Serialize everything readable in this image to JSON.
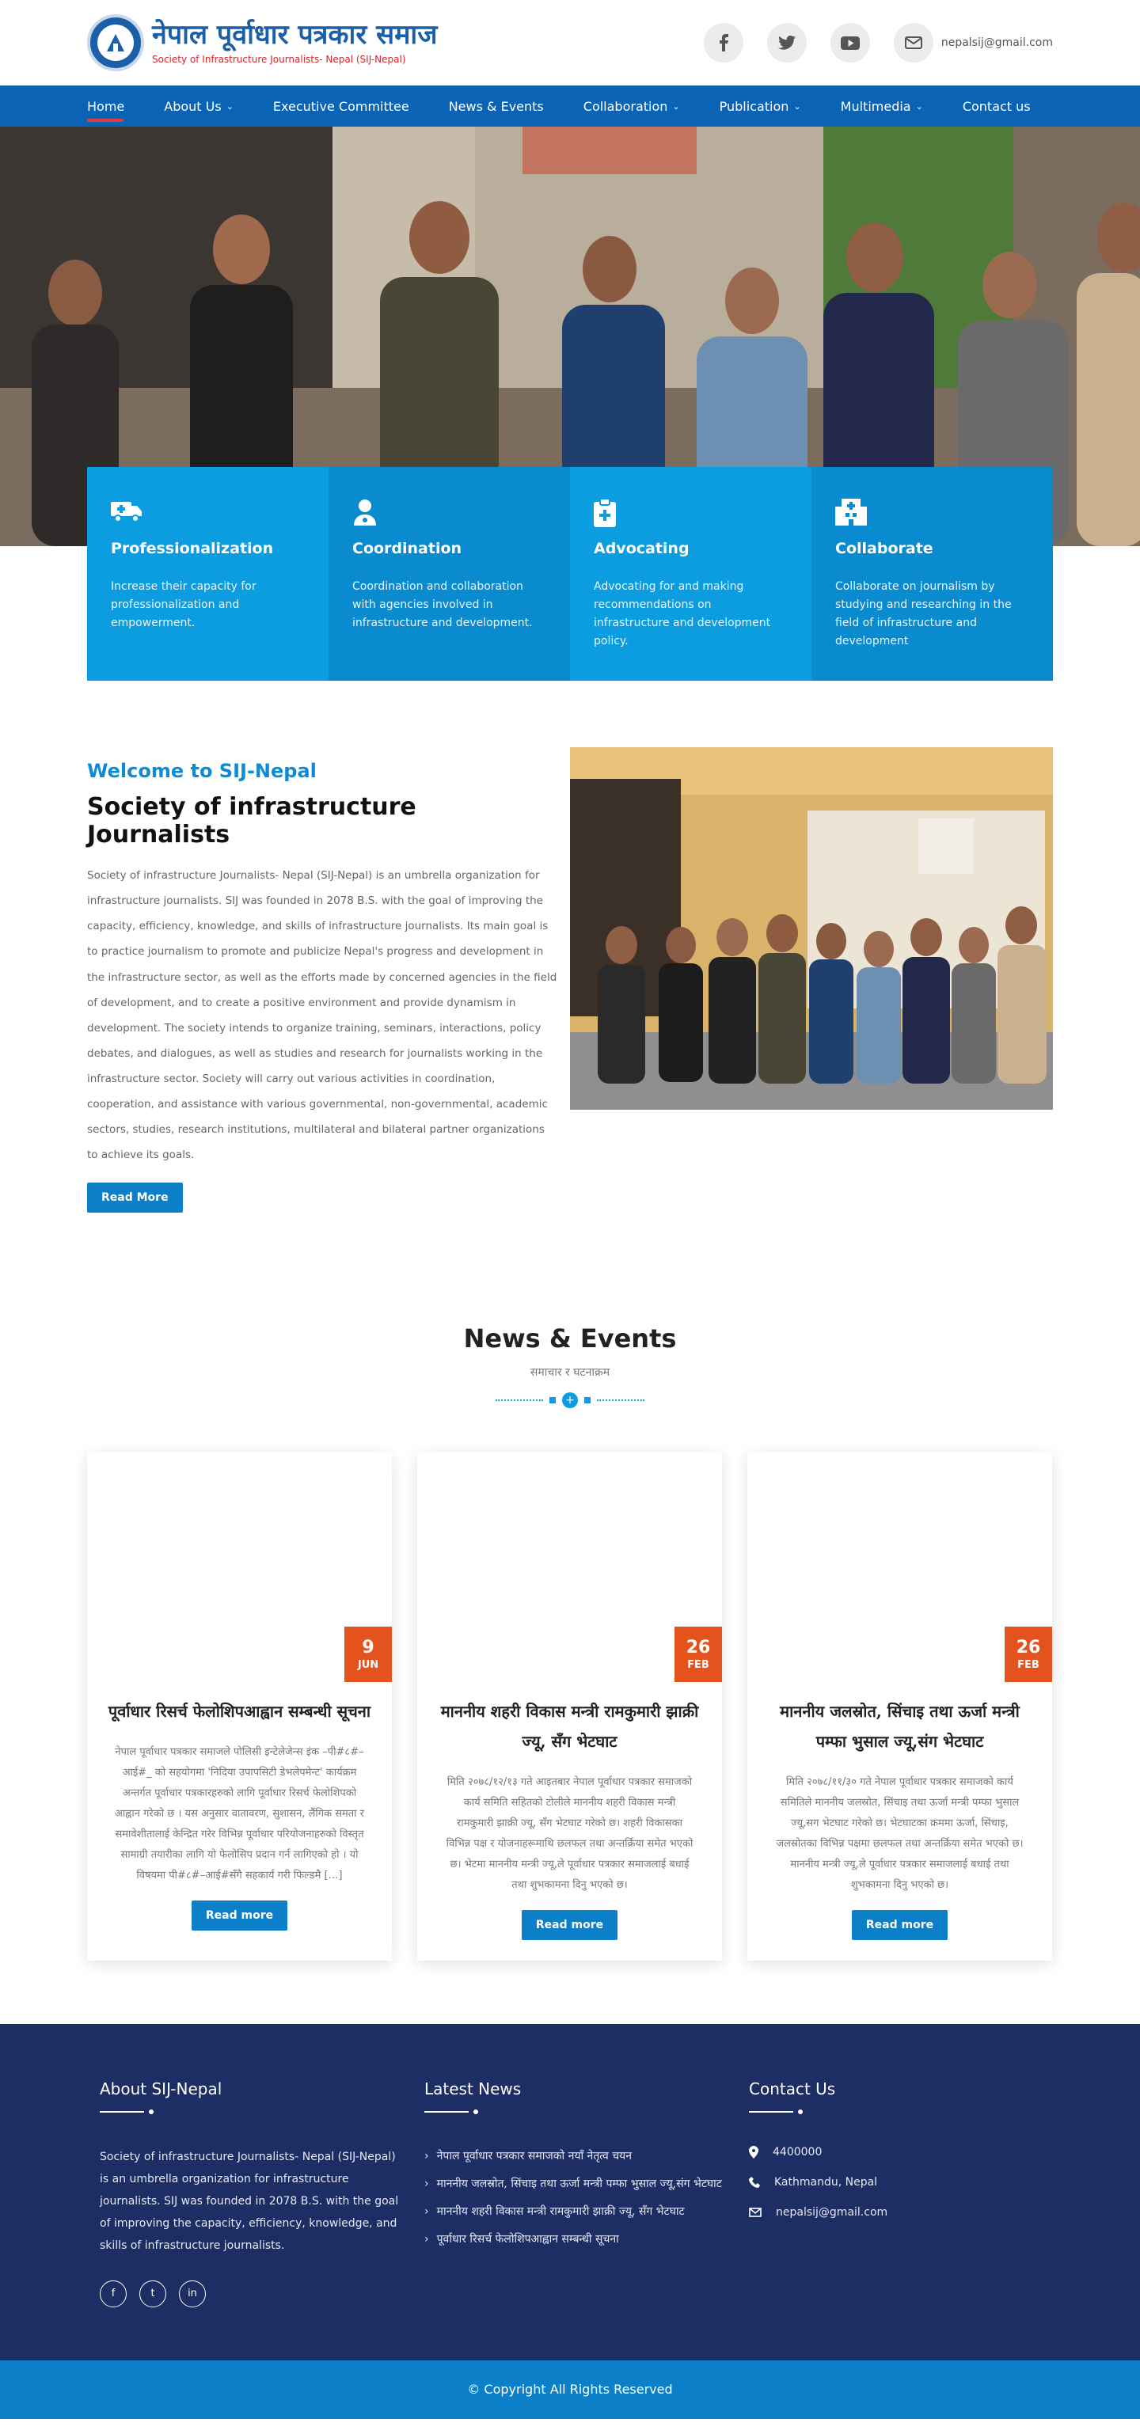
{
  "header": {
    "logo_np": "नेपाल पूर्वाधार पत्रकार समाज",
    "logo_en": "Society of Infrastructure Journalists- Nepal (SIJ-Nepal)",
    "email": "nepalsij@gmail.com",
    "social_icons": [
      "facebook-icon",
      "twitter-icon",
      "youtube-icon",
      "mail-icon"
    ]
  },
  "nav": {
    "items": [
      "Home",
      "About Us",
      "Executive Committee",
      "News & Events",
      "Collaboration",
      "Publication",
      "Multimedia",
      "Contact us"
    ],
    "active": "Home"
  },
  "features": [
    {
      "icon": "ambulance-icon",
      "title": "Professionalization",
      "text": "Increase their capacity for professionalization and empowerment."
    },
    {
      "icon": "user-doctor-icon",
      "title": "Coordination",
      "text": "Coordination and collaboration with agencies involved in infrastructure and development."
    },
    {
      "icon": "clipboard-medical-icon",
      "title": "Advocating",
      "text": "Advocating for and making recommendations on infrastructure and development policy."
    },
    {
      "icon": "hospital-icon",
      "title": "Collaborate",
      "text": "Collaborate on journalism by studying and researching in the field of infrastructure and development"
    }
  ],
  "welcome": {
    "kicker": "Welcome to SIJ-Nepal",
    "title": "Society of infrastructure Journalists",
    "body": "Society of infrastructure Journalists- Nepal (SIJ-Nepal) is an umbrella organization for infrastructure journalists. SIJ was founded in 2078 B.S. with the goal of improving the capacity, efficiency, knowledge, and skills of infrastructure journalists. Its main goal is to practice journalism to promote and publicize Nepal's progress and development in the infrastructure sector, as well as the efforts made by concerned agencies in the field of development, and to create a positive environment and provide dynamism in development. The society intends to organize training, seminars, interactions, policy debates, and dialogues, as well as studies and research for journalists working in the infrastructure sector. Society will carry out various activities in coordination, cooperation, and assistance with various governmental, non-governmental, academic sectors, studies, research institutions, multilateral and bilateral partner organizations to achieve its goals.",
    "button": "Read More"
  },
  "news": {
    "title": "News & Events",
    "subtitle": "समाचार र घटनाक्रम",
    "read_more": "Read more",
    "cards": [
      {
        "day": "9",
        "month": "JUN",
        "title": "पूर्वाधार रिसर्च फेलोशिपआह्वान सम्बन्धी सूचना",
        "body": "नेपाल पूर्वाधार पत्रकार समाजले पोलिसी इन्टेलेजेन्स इंक –पी#८#–आई#_ को सहयोगमा 'निदिया उपापसिटी डेभलेपमेन्ट' कार्यक्रम अन्तर्गत पूर्वाधार पत्रकारहरुको लागि पूर्वाधार रिसर्च फेलोशिपको आह्वान गरेको छ । यस अनुसार वातावरण, सुशासन, लैंगिक समता र समावेशीतालाई केन्द्रित गरेर विभिन्न पूर्वाधार परियोजनाहरुको विस्तृत सामाग्री तयारीका लागि यो फेलोसिप प्रदान गर्न लागिएको हो । यो विषयमा पी#८#–आई#सँगै सहकार्य गरी फिल्डमै […]"
      },
      {
        "day": "26",
        "month": "FEB",
        "title": "माननीय शहरी विकास मन्त्री रामकुमारी झाक्री ज्यू, सँग भेटघाट",
        "body": "मिति २०७८/१२/१३ गते आइतबार नेपाल पूर्वाधार पत्रकार समाजको कार्य समिति सहितको टोलीले माननीय शहरी विकास मन्त्री रामकुमारी झाक्री ज्यू, सँग भेटघाट गरेको छ। शहरी विकासका विभिन्न पक्ष र योजनाहरूमाथि छलफल तथा अन्तर्क्रिया समेत भएको छ। भेटमा माननीय मन्त्री ज्यू,ले पूर्वाधार पत्रकार समाजलाई बधाई तथा शुभकामना दिनु भएको छ।"
      },
      {
        "day": "26",
        "month": "FEB",
        "title": "माननीय जलस्रोत, सिंचाइ तथा ऊर्जा मन्त्री पम्फा भुसाल ज्यू,संग भेटघाट",
        "body": "मिति २०७८/११/३० गते नेपाल पूर्वाधार पत्रकार समाजको कार्य समितिले माननीय जलस्रोत, सिंचाइ तथा ऊर्जा मन्त्री पम्फा भुसाल ज्यू,सग भेटघाट गरेको छ। भेटघाटका क्रममा ऊर्जा, सिंचाइ, जलस्रोतका विभिन्न पक्षमा छलफल तथा अन्तर्क्रिया समेत भएको छ। माननीय मन्त्री ज्यू,ले पूर्वाधार पत्रकार समाजलाई बधाई तथा शुभकामना दिनु भएको छ।"
      }
    ]
  },
  "footer": {
    "about_title": "About SIJ-Nepal",
    "about_text": "Society of infrastructure Journalists- Nepal (SIJ-Nepal) is an umbrella organization for infrastructure journalists. SIJ was founded in 2078 B.S. with the goal of improving the capacity, efficiency, knowledge, and skills of infrastructure journalists.",
    "social": [
      "f",
      "t",
      "in"
    ],
    "latest_title": "Latest News",
    "latest": [
      "नेपाल पूर्वाधार पत्रकार समाजको नयाँ नेतृत्व चयन",
      "माननीय जलस्रोत, सिंचाइ तथा ऊर्जा मन्त्री पम्फा भुसाल ज्यू,संग भेटघाट",
      "माननीय शहरी विकास मन्त्री रामकुमारी झाक्री ज्यू, सँग भेटघाट",
      "पूर्वाधार रिसर्च फेलोशिपआह्वान सम्बन्धी सूचना"
    ],
    "contact_title": "Contact Us",
    "phone": "4400000",
    "address": "Kathmandu, Nepal",
    "email": "nepalsij@gmail.com",
    "copyright": "© Copyright All Rights Reserved"
  }
}
